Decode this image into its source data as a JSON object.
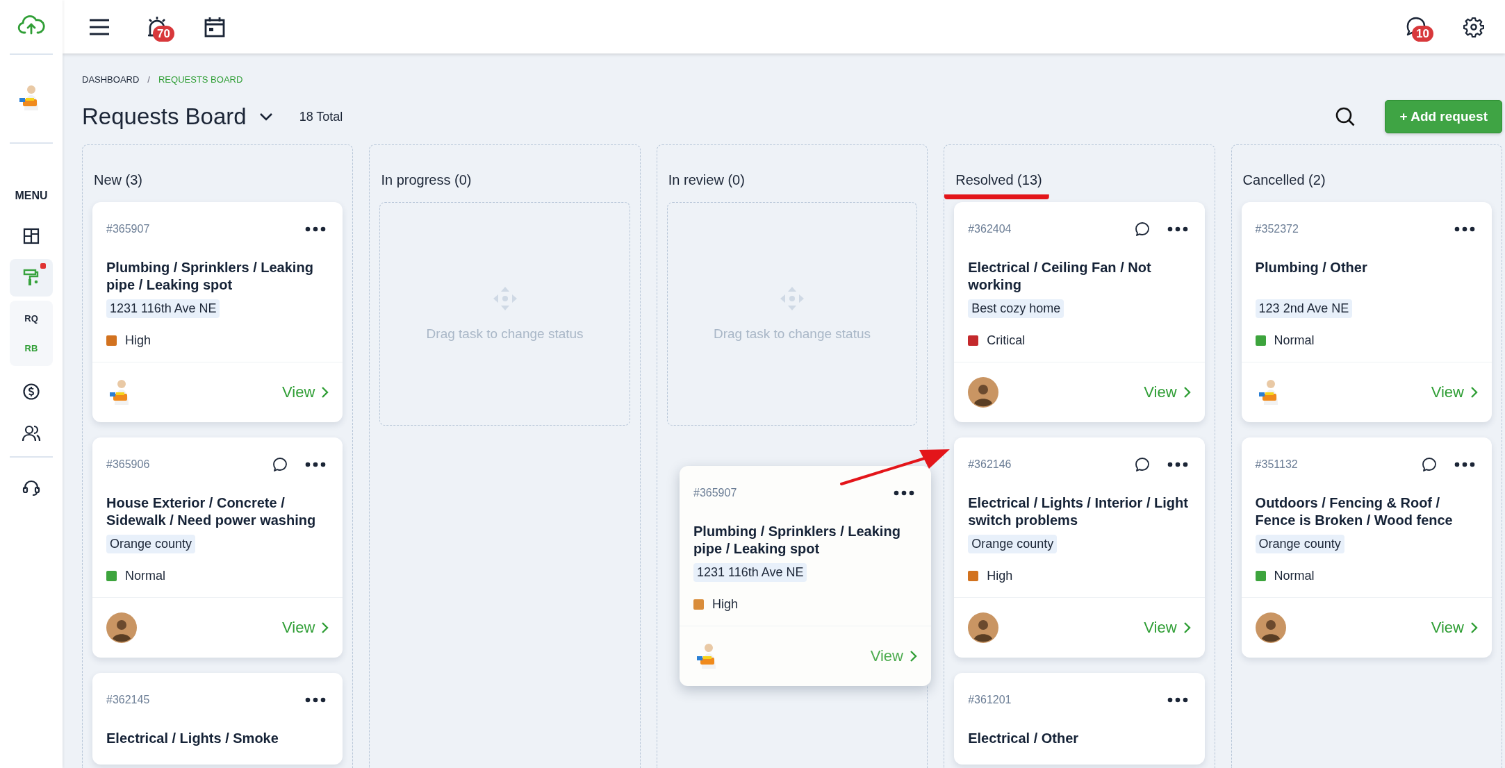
{
  "topbar": {
    "alarm_badge": "70",
    "chat_badge": "10"
  },
  "sidebar": {
    "menu_label": "MENU",
    "items": [
      {
        "kind": "icon",
        "selected": false,
        "dot": false
      },
      {
        "kind": "icon",
        "selected": true,
        "dot": true
      },
      {
        "kind": "sub",
        "labels": [
          {
            "label": "RQ",
            "selected": false
          },
          {
            "label": "RB",
            "selected": true
          }
        ]
      },
      {
        "kind": "icon",
        "selected": false,
        "dot": false
      },
      {
        "kind": "icon",
        "selected": false,
        "dot": false
      }
    ]
  },
  "breadcrumb": [
    {
      "label": "DASHBOARD",
      "selected": false
    },
    {
      "label": "REQUESTS BOARD",
      "selected": true
    }
  ],
  "breadcrumb_separator": "/",
  "title": "Requests Board",
  "total": "18 Total",
  "add_button": "+ Add request",
  "columns": [
    {
      "title": "New (3)",
      "highlighted": false,
      "cards": [
        {
          "id": "#365907",
          "comment": false,
          "title": "Plumbing / Sprinklers / Leaking pipe / Leaking spot",
          "tag": "1231 116th Ave NE",
          "priority": {
            "label": "High",
            "color": "#d2721f"
          },
          "avatar": {
            "kind": "cutout"
          },
          "link": "View"
        },
        {
          "id": "#365906",
          "comment": true,
          "title": "House Exterior / Concrete / Sidewalk / Need power washing",
          "tag": "Orange county",
          "priority": {
            "label": "Normal",
            "color": "#3da43d"
          },
          "avatar": {
            "kind": "round"
          },
          "link": "View"
        },
        {
          "id": "#362145",
          "comment": false,
          "title": "Electrical / Lights / Smoke"
        }
      ]
    },
    {
      "title": "In progress (0)",
      "highlighted": false,
      "placeholder": "Drag task to change status"
    },
    {
      "title": "In review (0)",
      "highlighted": false,
      "placeholder": "Drag task to change status"
    },
    {
      "title": "Resolved (13)",
      "highlighted": true,
      "cards": [
        {
          "id": "#362404",
          "comment": true,
          "title": "Electrical / Ceiling Fan / Not working",
          "tag": "Best cozy home",
          "priority": {
            "label": "Critical",
            "color": "#c4292c"
          },
          "avatar": {
            "kind": "round"
          },
          "link": "View"
        },
        {
          "id": "#362146",
          "comment": true,
          "title": "Electrical / Lights / Interior / Light switch problems",
          "tag": "Orange county",
          "priority": {
            "label": "High",
            "color": "#d2721f"
          },
          "avatar": {
            "kind": "round"
          },
          "link": "View"
        },
        {
          "id": "#361201",
          "comment": false,
          "title": "Electrical / Other"
        }
      ]
    },
    {
      "title": "Cancelled (2)",
      "highlighted": false,
      "cards": [
        {
          "id": "#352372",
          "comment": false,
          "title": "Plumbing / Other",
          "tag": "123 2nd Ave NE",
          "priority": {
            "label": "Normal",
            "color": "#3da43d"
          },
          "avatar": {
            "kind": "cutout"
          },
          "link": "View"
        },
        {
          "id": "#351132",
          "comment": true,
          "title": "Outdoors / Fencing & Roof / Fence is Broken / Wood fence",
          "tag": "Orange county",
          "priority": {
            "label": "Normal",
            "color": "#3da43d"
          },
          "avatar": {
            "kind": "round"
          },
          "link": "View"
        }
      ]
    }
  ],
  "dragged_card": {
    "id": "#365907",
    "comment": false,
    "title": "Plumbing / Sprinklers / Leaking pipe / Leaking spot",
    "tag": "1231 116th Ave NE",
    "priority": {
      "label": "High",
      "color": "#d98c3a"
    },
    "avatar": {
      "kind": "cutout"
    },
    "link": "View"
  }
}
